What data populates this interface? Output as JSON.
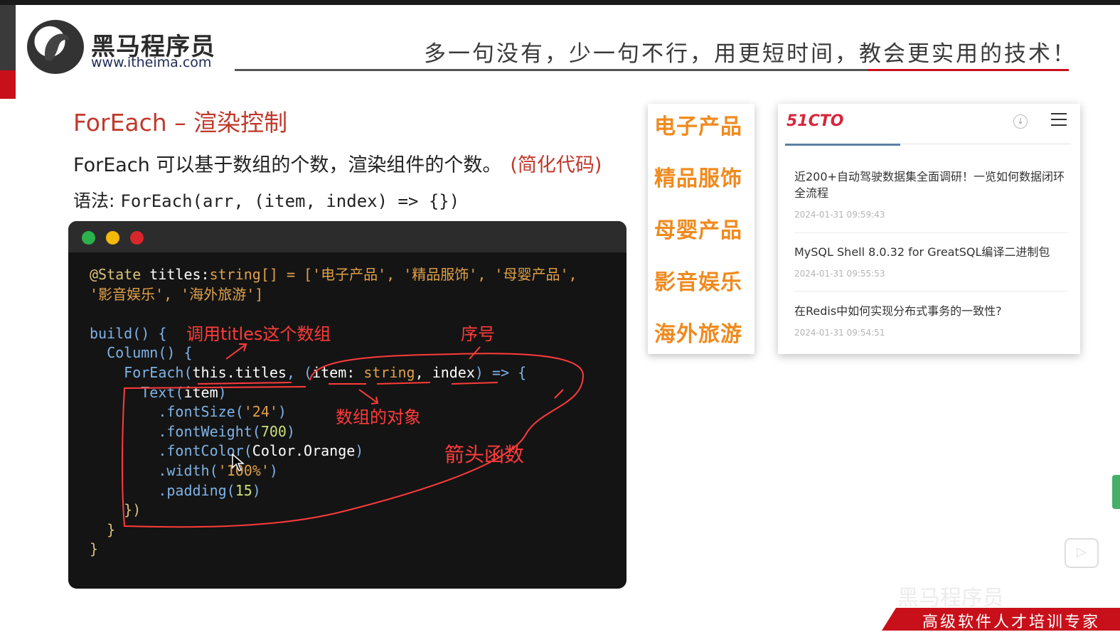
{
  "header": {
    "brand_name": "黑马程序员",
    "brand_url": "www.itheima.com",
    "slogan": "多一句没有，少一句不行，用更短时间，教会更实用的技术！",
    "logo_icon": "horse-logo-icon"
  },
  "slide": {
    "heading": "ForEach – 渲染控制",
    "description": "ForEach 可以基于数组的个数，渲染组件的个数。",
    "description_highlight": "(简化代码)",
    "syntax_label": "语法: ",
    "syntax_code": "ForEach(arr, (item, index) => {})"
  },
  "code": {
    "line1_decorator": "@State",
    "line1_name": " titles:",
    "line1_type": "string[]",
    "line1_eq": " = [",
    "line1_vals": "'电子产品', '精品服饰', '母婴产品',",
    "line2_vals": "'影音娱乐', '海外旅游'",
    "line2_end": "]",
    "build": "build() {",
    "column": "  Column() {",
    "foreach_kw": "    ForEach(",
    "foreach_this": "this.titles",
    "foreach_comma": ", (",
    "foreach_item": "item",
    "foreach_colon": ": ",
    "foreach_type": "string",
    "foreach_sep": ", ",
    "foreach_index": "index",
    "foreach_arrow": ") => {",
    "text_fn": "      Text(",
    "text_arg": "item",
    "text_close": ")",
    "fontsize_fn": "        .fontSize(",
    "fontsize_val": "'24'",
    "fontweight_fn": "        .fontWeight(",
    "fontweight_val": "700",
    "fontcolor_fn": "        .fontColor(",
    "fontcolor_val": "Color.Orange",
    "width_fn": "        .width(",
    "width_val": "'100%'",
    "padding_fn": "        .padding(",
    "padding_val": "15",
    "close1": "    })",
    "close2": "  }",
    "close3": "}",
    "close_paren": ")"
  },
  "annotations": {
    "titles_array": "调用titles这个数组",
    "index_label": "序号",
    "item_label": "数组的对象",
    "arrow_fn": "箭头函数"
  },
  "categories": [
    "电子产品",
    "精品服饰",
    "母婴产品",
    "影音娱乐",
    "海外旅游"
  ],
  "news": {
    "logo": "51CTO",
    "items": [
      {
        "title": "近200+自动驾驶数据集全面调研！一览如何数据闭环全流程",
        "time": "2024-01-31 09:59:43"
      },
      {
        "title": "MySQL Shell 8.0.32 for GreatSQL编译二进制包",
        "time": "2024-01-31 09:55:53"
      },
      {
        "title": "在Redis中如何实现分布式事务的一致性?",
        "time": "2024-01-31 09:54:51"
      }
    ]
  },
  "footer": {
    "tagline": "高级软件人才培训专家",
    "watermark": "黑马程序员"
  },
  "colors": {
    "accent_red": "#c8101a",
    "heading_red": "#c0392b",
    "category_orange": "#f08a1e",
    "code_bg": "#141414",
    "annotation_red": "#ff3b3b"
  }
}
